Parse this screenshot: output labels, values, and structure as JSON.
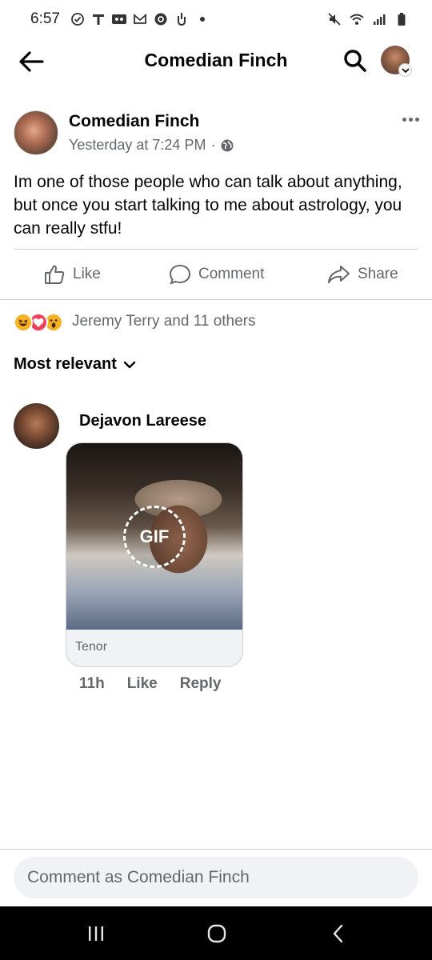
{
  "status_bar": {
    "time": "6:57",
    "left_icons": [
      "check-circle-icon",
      "t-mobile-icon",
      "voicemail-icon",
      "gmail-icon",
      "threads-icon",
      "hand-icon",
      "dot-icon"
    ],
    "right_icons": [
      "mute-icon",
      "wifi-icon",
      "signal-icon",
      "battery-icon"
    ]
  },
  "header": {
    "title": "Comedian Finch"
  },
  "post": {
    "author": "Comedian Finch",
    "timestamp": "Yesterday at 7:24 PM",
    "separator": "·",
    "text": "Im one of those people who can talk about anything,  but once you start talking to me about astrology, you can really stfu!"
  },
  "actions": {
    "like": "Like",
    "comment": "Comment",
    "share": "Share"
  },
  "reactions": {
    "icons": [
      "haha",
      "love",
      "wow"
    ],
    "summary": "Jeremy Terry and 11 others"
  },
  "sort": {
    "label": "Most relevant"
  },
  "comments": [
    {
      "author": "Dejavon Lareese",
      "gif_badge": "GIF",
      "gif_source": "Tenor",
      "time": "11h",
      "like": "Like",
      "reply": "Reply"
    }
  ],
  "composer": {
    "placeholder": "Comment as Comedian Finch"
  },
  "colors": {
    "text_primary": "#050505",
    "text_secondary": "#65676b",
    "divider": "#ced0d4",
    "composer_bg": "#f0f2f5",
    "love": "#f33e58",
    "haha": "#f7b125"
  }
}
